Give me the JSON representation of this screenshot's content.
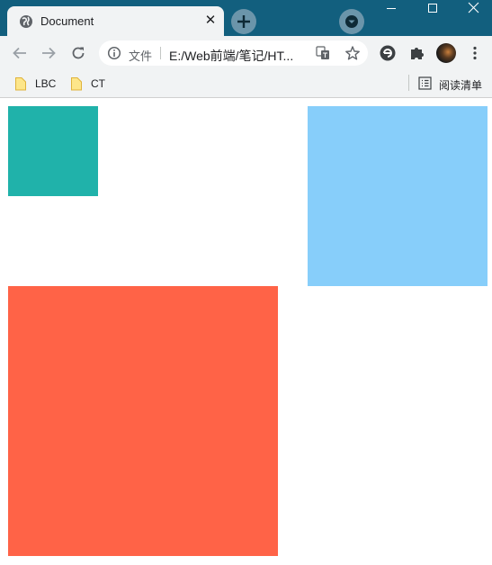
{
  "tab": {
    "title": "Document",
    "close": "✕"
  },
  "toolbar": {
    "security_label": "文件",
    "url": "E:/Web前端/笔记/HT..."
  },
  "bookmarks": [
    {
      "label": "LBC"
    },
    {
      "label": "CT"
    }
  ],
  "reading_list": {
    "label": "阅读清单"
  },
  "boxes": [
    {
      "color": "#20b2aa"
    },
    {
      "color": "#87cefa"
    },
    {
      "color": "#ff6347"
    }
  ]
}
